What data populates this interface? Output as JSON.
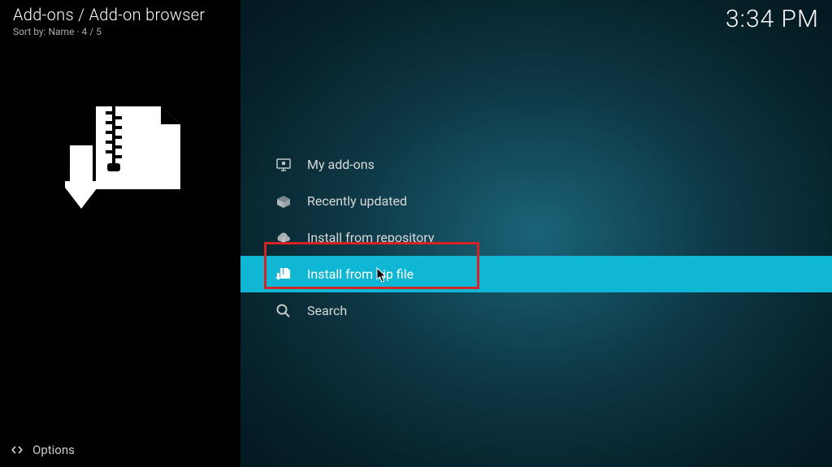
{
  "header": {
    "breadcrumb": "Add-ons / Add-on browser",
    "sort_label": "Sort by: Name  · 4 / 5",
    "clock": "3:34 PM"
  },
  "menu": {
    "items": [
      {
        "label": "My add-ons"
      },
      {
        "label": "Recently updated"
      },
      {
        "label": "Install from repository"
      },
      {
        "label": "Install from zip file"
      },
      {
        "label": "Search"
      }
    ]
  },
  "footer": {
    "options_label": "Options"
  }
}
